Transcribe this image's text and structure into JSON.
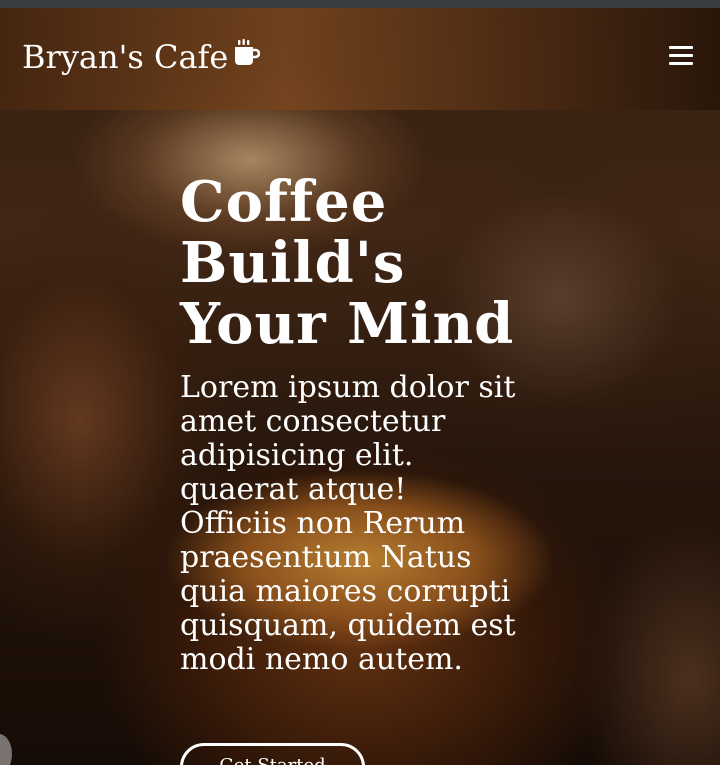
{
  "navbar": {
    "brand_name": "Bryan's Cafe",
    "brand_icon": "mug-hot-icon",
    "menu_icon": "hamburger-menu-icon"
  },
  "hero": {
    "title": "Coffee Build's Your Mind",
    "text": "Lorem ipsum dolor sit amet consectetur adipisicing elit. quaerat atque! Officiis non Rerum praesentium Natus quia maiores corrupti quisquam, quidem est modi nemo autem.",
    "button_label": "Get Started",
    "background": "coffee-cup-photo"
  },
  "colors": {
    "text": "#ffffff",
    "navbar": "#5a3418",
    "top_strip": "#3a3d40"
  }
}
